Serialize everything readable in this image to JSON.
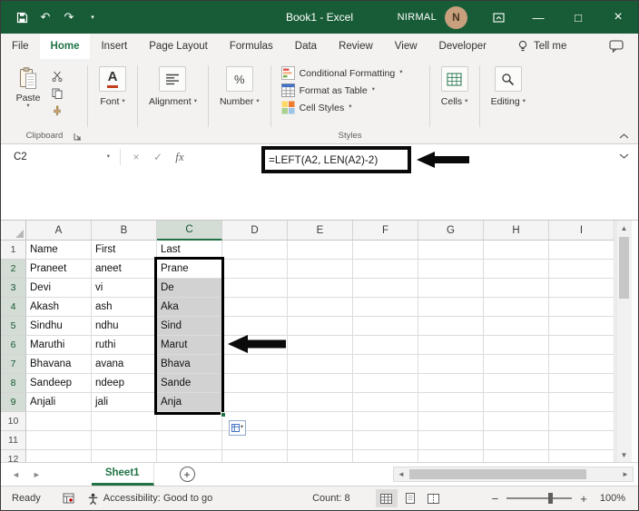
{
  "window": {
    "title": "Book1 - Excel",
    "user": "NIRMAL",
    "avatar_initial": "N"
  },
  "icons": {
    "undo": "↶",
    "redo": "↷",
    "dropdown": "▾",
    "minimize": "—",
    "maximize": "□",
    "close": "×",
    "cancel": "×",
    "enter": "✓",
    "scroll_up": "▲",
    "scroll_down": "▼",
    "scroll_left": "◄",
    "scroll_right": "►",
    "add": "+",
    "zoom_out": "−",
    "zoom_in": "+"
  },
  "ribbon": {
    "tabs": [
      "File",
      "Home",
      "Insert",
      "Page Layout",
      "Formulas",
      "Data",
      "Review",
      "View",
      "Developer"
    ],
    "active_tab": "Home",
    "tell_me": "Tell me",
    "paste_label": "Paste",
    "clipboard_group_label": "Clipboard",
    "font_label": "Font",
    "font_glyph": "A",
    "alignment_label": "Alignment",
    "number_label": "Number",
    "number_glyph": "%",
    "styles_buttons": [
      "Conditional Formatting",
      "Format as Table",
      "Cell Styles"
    ],
    "styles_group_label": "Styles",
    "cells_label": "Cells",
    "editing_label": "Editing"
  },
  "formula_bar": {
    "name_box": "C2",
    "fx_label": "fx",
    "formula": "=LEFT(A2, LEN(A2)-2)"
  },
  "grid": {
    "columns": [
      "A",
      "B",
      "C",
      "D",
      "E",
      "F",
      "G",
      "H",
      "I"
    ],
    "visible_rows": 12,
    "cells": {
      "1": {
        "A": "Name",
        "B": "First",
        "C": "Last"
      },
      "2": {
        "A": "Praneet",
        "B": "aneet",
        "C": "Prane"
      },
      "3": {
        "A": "Devi",
        "B": "vi",
        "C": "De"
      },
      "4": {
        "A": "Akash",
        "B": "ash",
        "C": "Aka"
      },
      "5": {
        "A": "Sindhu",
        "B": "ndhu",
        "C": "Sind"
      },
      "6": {
        "A": "Maruthi",
        "B": "ruthi",
        "C": "Marut"
      },
      "7": {
        "A": "Bhavana",
        "B": "avana",
        "C": "Bhava"
      },
      "8": {
        "A": "Sandeep",
        "B": "ndeep",
        "C": "Sande"
      },
      "9": {
        "A": "Anjali",
        "B": "jali",
        "C": "Anja"
      }
    },
    "selection": {
      "column": "C",
      "from_row": 2,
      "to_row": 9,
      "active_cell": "C2"
    }
  },
  "sheet_bar": {
    "active_tab": "Sheet1"
  },
  "status_bar": {
    "mode": "Ready",
    "accessibility": "Accessibility: Good to go",
    "count": "Count: 8",
    "zoom_level": "100%"
  },
  "colors": {
    "titlebar": "#185C37",
    "excel_green": "#217346",
    "selection_fill": "#D2D2D2",
    "annotation": "#000000"
  }
}
